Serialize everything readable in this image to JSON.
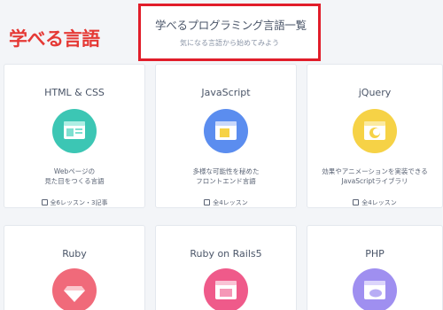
{
  "annotation": {
    "label": "学べる言語"
  },
  "header": {
    "title": "学べるプログラミング言語一覧",
    "subtitle": "気になる言語から始めてみよう"
  },
  "cards": [
    {
      "name": "HTML & CSS",
      "icon": "html-css-window-icon",
      "color": "#3cc6b4",
      "desc": "Webページの\n見た目をつくる言語",
      "meta": "全6レッスン・3記事"
    },
    {
      "name": "JavaScript",
      "icon": "javascript-window-icon",
      "color": "#5b8def",
      "desc": "多様な可能性を秘めた\nフロントエンド言語",
      "meta": "全4レッスン"
    },
    {
      "name": "jQuery",
      "icon": "jquery-window-icon",
      "color": "#f6d246",
      "desc": "効果やアニメーションを実装できる\nJavaScriptライブラリ",
      "meta": "全4レッスン"
    },
    {
      "name": "Ruby",
      "icon": "ruby-gem-icon",
      "color": "#f06a7a",
      "desc": "",
      "meta": ""
    },
    {
      "name": "Ruby on Rails5",
      "icon": "rails-window-icon",
      "color": "#ef5a8a",
      "desc": "",
      "meta": ""
    },
    {
      "name": "PHP",
      "icon": "php-elephant-icon",
      "color": "#9f8ff0",
      "desc": "",
      "meta": ""
    }
  ]
}
